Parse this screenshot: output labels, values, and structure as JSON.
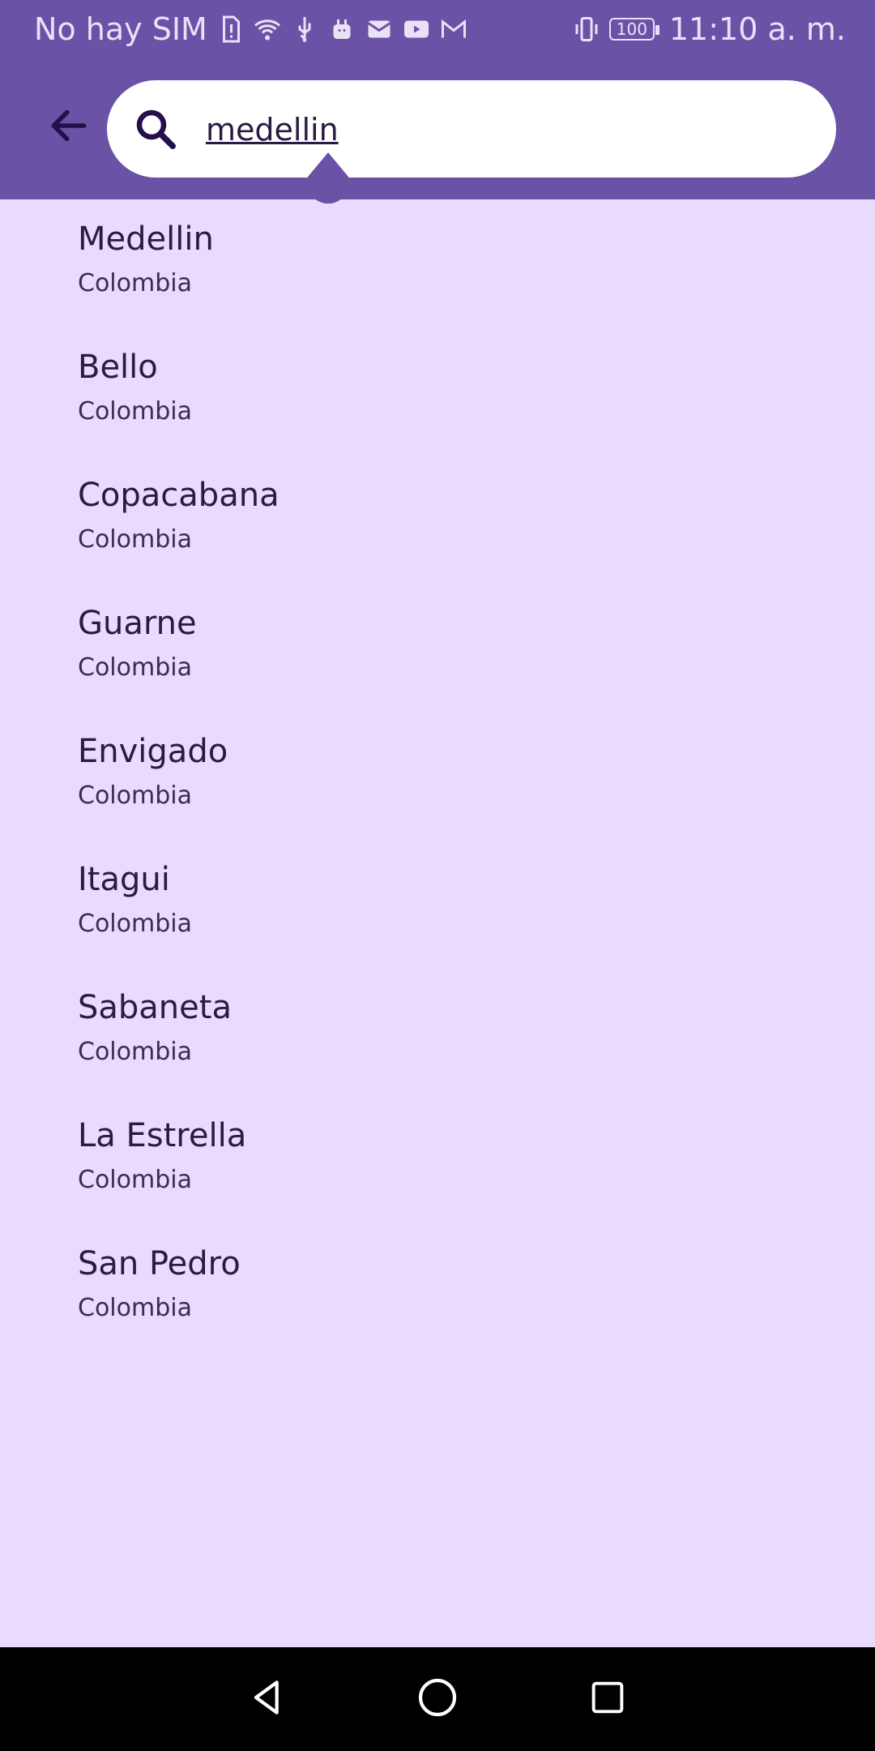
{
  "status_bar": {
    "carrier": "No hay SIM",
    "battery_level": "100",
    "time": "11:10 a. m."
  },
  "search": {
    "query": "medellin",
    "placeholder": ""
  },
  "results": [
    {
      "city": "Medellin",
      "country": "Colombia"
    },
    {
      "city": "Bello",
      "country": "Colombia"
    },
    {
      "city": "Copacabana",
      "country": "Colombia"
    },
    {
      "city": "Guarne",
      "country": "Colombia"
    },
    {
      "city": "Envigado",
      "country": "Colombia"
    },
    {
      "city": "Itagui",
      "country": "Colombia"
    },
    {
      "city": "Sabaneta",
      "country": "Colombia"
    },
    {
      "city": "La Estrella",
      "country": "Colombia"
    },
    {
      "city": "San Pedro",
      "country": "Colombia"
    }
  ],
  "colors": {
    "appbar": "#6a52a6",
    "background": "#e8dbfd",
    "text_primary": "#2a1a44"
  },
  "icons": [
    "sim-alert-icon",
    "wifi-icon",
    "usb-icon",
    "android-icon",
    "mail-icon",
    "youtube-icon",
    "gmail-icon",
    "vibrate-icon",
    "battery-icon",
    "back-arrow-icon",
    "search-icon",
    "nav-back-icon",
    "nav-home-icon",
    "nav-recents-icon"
  ]
}
